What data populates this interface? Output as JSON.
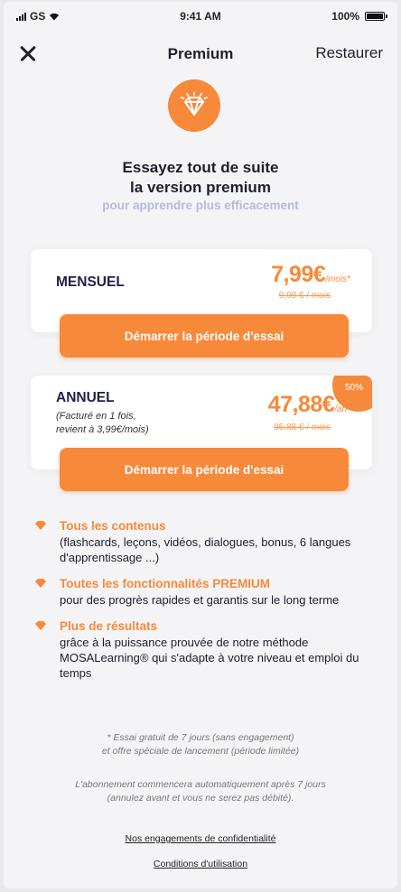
{
  "status_bar": {
    "carrier": "GS",
    "time": "9:41 AM",
    "battery": "100%"
  },
  "navbar": {
    "title": "Premium",
    "restore_label": "Restaurer"
  },
  "hero": {
    "title_line1": "Essayez tout de suite",
    "title_line2": "la version premium",
    "subtitle": "pour apprendre plus efficacement",
    "icon": "diamond-icon"
  },
  "plans": [
    {
      "name": "MENSUEL",
      "price": "7,99€",
      "unit": "/mois*",
      "old_price": "9,99 € / mois",
      "cta_label": "Démarrer la période d'essai"
    },
    {
      "name": "ANNUEL",
      "note_line1": "(Facturé en 1 fois,",
      "note_line2": "revient à 3,99€/mois)",
      "price": "47,88€",
      "unit": "/an*",
      "old_price": "95,88 € / mois",
      "badge": "50%",
      "cta_label": "Démarrer la période d'essai"
    }
  ],
  "features": [
    {
      "title": "Tous les contenus",
      "desc": "(flashcards, leçons, vidéos, dialogues, bonus, 6 langues d'apprentissage ...)"
    },
    {
      "title": "Toutes les fonctionnalités PREMIUM",
      "desc": "pour des progrès rapides et garantis sur le long terme"
    },
    {
      "title": "Plus de résultats",
      "desc": "grâce à la puissance prouvée de notre méthode MOSALearning® qui s'adapte à votre niveau et emploi du temps"
    }
  ],
  "fine_print": {
    "trial_line1": "* Essai gratuit de 7 jours (sans engagement)",
    "trial_line2": "et offre spéciale de lancement (période limitée)",
    "auto_line1": "L'abonnement commencera automatiquement après 7 jours",
    "auto_line2": "(annulez avant et vous ne serez pas débité)."
  },
  "links": {
    "privacy": "Nos engagements de confidentialité",
    "terms": "Conditions d'utilisation"
  },
  "colors": {
    "accent": "#f7893a",
    "subtitle": "#b7b9dc",
    "plan_name": "#1e2047"
  }
}
